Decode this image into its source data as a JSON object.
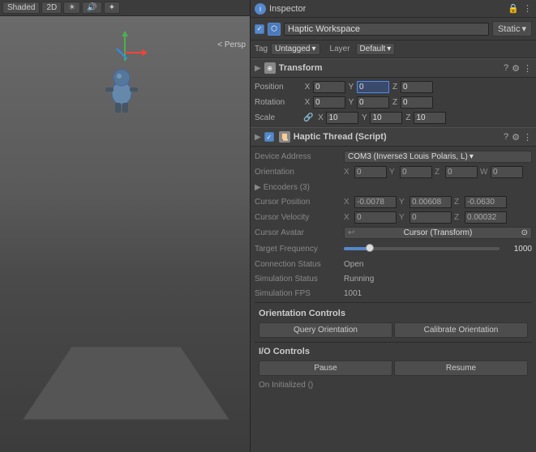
{
  "inspector": {
    "title": "Inspector",
    "gameobject": {
      "name": "Haptic Workspace",
      "static_label": "Static",
      "tag_label": "Tag",
      "tag_value": "Untagged",
      "layer_label": "Layer",
      "layer_value": "Default"
    },
    "transform": {
      "title": "Transform",
      "position_label": "Position",
      "rotation_label": "Rotation",
      "scale_label": "Scale",
      "position": {
        "x": "0",
        "y": "0",
        "z": "0"
      },
      "rotation": {
        "x": "0",
        "y": "0",
        "z": "0"
      },
      "scale": {
        "x": "10",
        "y": "10",
        "z": "10"
      },
      "position_y_highlighted": "0"
    },
    "haptic_thread": {
      "title": "Haptic Thread (Script)",
      "device_address_label": "Device Address",
      "device_address_value": "COM3 (Inverse3 Louis Polaris, L)",
      "orientation_label": "Orientation",
      "orientation": {
        "x": "0",
        "y": "0",
        "z": "0",
        "w": "0"
      },
      "encoders_label": "Encoders (3)",
      "cursor_position_label": "Cursor Position",
      "cursor_position": {
        "x": "-0.0078",
        "y": "0.00608",
        "z": "-0.0630"
      },
      "cursor_velocity_label": "Cursor Velocity",
      "cursor_velocity": {
        "x": "0",
        "y": "0",
        "z": "0.00032"
      },
      "cursor_avatar_label": "Cursor Avatar",
      "cursor_avatar_value": "Cursor (Transform)",
      "target_frequency_label": "Target Frequency",
      "target_frequency_value": "1000",
      "connection_status_label": "Connection Status",
      "connection_status_value": "Open",
      "simulation_status_label": "Simulation Status",
      "simulation_status_value": "Running",
      "simulation_fps_label": "Simulation FPS",
      "simulation_fps_value": "1001",
      "orientation_controls_label": "Orientation Controls",
      "query_orientation_btn": "Query Orientation",
      "calibrate_orientation_btn": "Calibrate Orientation",
      "io_controls_label": "I/O Controls",
      "pause_btn": "Pause",
      "resume_btn": "Resume",
      "on_initialized_label": "On Initialized ()"
    }
  },
  "scene": {
    "persp_label": "< Persp"
  },
  "toolbar": {
    "tools": [
      "✋",
      "✥",
      "↺",
      "⊞",
      "⛶"
    ]
  }
}
